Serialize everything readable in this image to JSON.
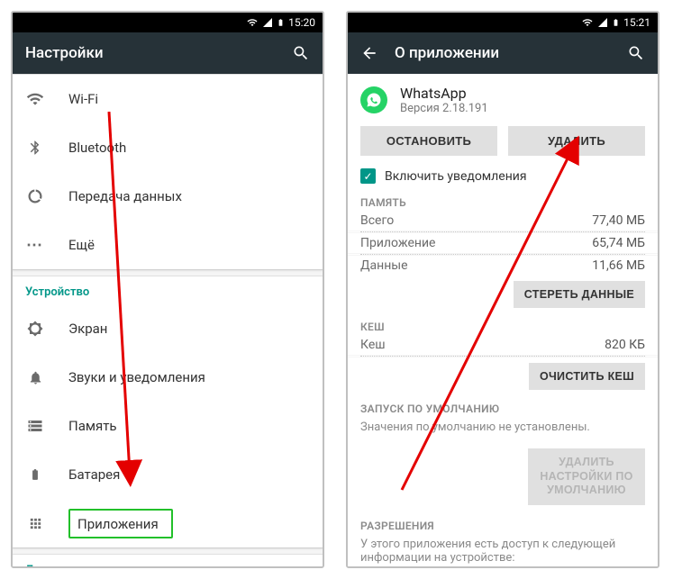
{
  "left": {
    "statusbar": {
      "time": "15:20"
    },
    "appbar": {
      "title": "Настройки"
    },
    "wireless": {
      "wifi": "Wi-Fi",
      "bluetooth": "Bluetooth",
      "data": "Передача данных",
      "more": "Ещё"
    },
    "device": {
      "header": "Устройство",
      "display": "Экран",
      "sound": "Звуки и уведомления",
      "storage": "Память",
      "battery": "Батарея",
      "apps": "Приложения"
    },
    "personal": {
      "header": "Личные данные"
    }
  },
  "right": {
    "statusbar": {
      "time": "15:21"
    },
    "appbar": {
      "title": "О приложении"
    },
    "app": {
      "name": "WhatsApp",
      "version": "Версия 2.18.191"
    },
    "buttons": {
      "stop": "ОСТАНОВИТЬ",
      "delete": "УДАЛИТЬ"
    },
    "notify": {
      "label": "Включить уведомления"
    },
    "memory": {
      "header": "ПАМЯТЬ",
      "total_k": "Всего",
      "total_v": "77,40 МБ",
      "app_k": "Приложение",
      "app_v": "65,74 МБ",
      "data_k": "Данные",
      "data_v": "11,66 МБ",
      "clear_data": "СТЕРЕТЬ ДАННЫЕ"
    },
    "cache": {
      "header": "КЕШ",
      "cache_k": "Кеш",
      "cache_v": "820 КБ",
      "clear_cache": "ОЧИСТИТЬ КЕШ"
    },
    "launch": {
      "header": "ЗАПУСК ПО УМОЛЧАНИЮ",
      "note": "Значения по умолчанию не установлены.",
      "clear_defaults": "УДАЛИТЬ НАСТРОЙКИ ПО УМОЛЧАНИЮ"
    },
    "perm": {
      "header": "РАЗРЕШЕНИЯ",
      "note": "У этого приложения есть доступ к следующей информации на устройстве:"
    }
  }
}
